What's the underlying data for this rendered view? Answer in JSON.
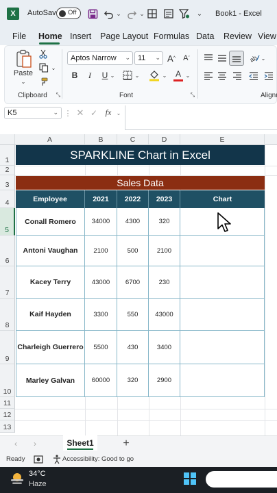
{
  "titlebar": {
    "app_logo": "X",
    "autosave_label": "AutoSave",
    "toggle_state": "Off",
    "book_title": "Book1  -  Excel",
    "icons": [
      "save-icon",
      "undo-icon",
      "redo-icon",
      "table-icon",
      "form-icon",
      "filter-icon",
      "more-icon"
    ]
  },
  "ribbon_tabs": [
    "File",
    "Home",
    "Insert",
    "Page Layout",
    "Formulas",
    "Data",
    "Review",
    "View"
  ],
  "ribbon": {
    "paste_label": "Paste",
    "clipboard_label": "Clipboard",
    "font_label": "Font",
    "alignment_label": "Alignm",
    "font_name": "Aptos Narrow",
    "font_size": "11",
    "bold": "B",
    "italic": "I",
    "underline": "U",
    "grow_font": "A",
    "shrink_font": "A",
    "font_color": "A"
  },
  "formula_bar": {
    "name_box": "K5",
    "fx": "fx",
    "value": ""
  },
  "columns": [
    "A",
    "B",
    "C",
    "D",
    "E"
  ],
  "rows": [
    "1",
    "2",
    "3",
    "4",
    "5",
    "6",
    "7",
    "8",
    "9",
    "10",
    "11",
    "12",
    "13"
  ],
  "sheet": {
    "title": "SPARKLINE Chart in Excel",
    "subtitle": "Sales Data",
    "headers": [
      "Employee",
      "2021",
      "2022",
      "2023",
      "Chart"
    ],
    "data": [
      {
        "name": "Conall Romero",
        "y2021": "34000",
        "y2022": "4300",
        "y2023": "320"
      },
      {
        "name": "Antoni Vaughan",
        "y2021": "2100",
        "y2022": "500",
        "y2023": "2100"
      },
      {
        "name": "Kacey Terry",
        "y2021": "43000",
        "y2022": "6700",
        "y2023": "230"
      },
      {
        "name": "Kaif Hayden",
        "y2021": "3300",
        "y2022": "550",
        "y2023": "43000"
      },
      {
        "name": "Charleigh Guerrero",
        "y2021": "5500",
        "y2022": "430",
        "y2023": "3400"
      },
      {
        "name": "Marley Galvan",
        "y2021": "60000",
        "y2022": "320",
        "y2023": "2900"
      }
    ]
  },
  "sheet_tabs": {
    "active": "Sheet1",
    "add": "+"
  },
  "status": {
    "ready": "Ready",
    "accessibility": "Accessibility: Good to go"
  },
  "taskbar": {
    "temperature": "34°C",
    "condition": "Haze"
  },
  "colors": {
    "excel_green": "#1e7145",
    "title_banner": "#12354a",
    "subtitle_banner": "#8b2e12",
    "table_header": "#1f5064"
  }
}
